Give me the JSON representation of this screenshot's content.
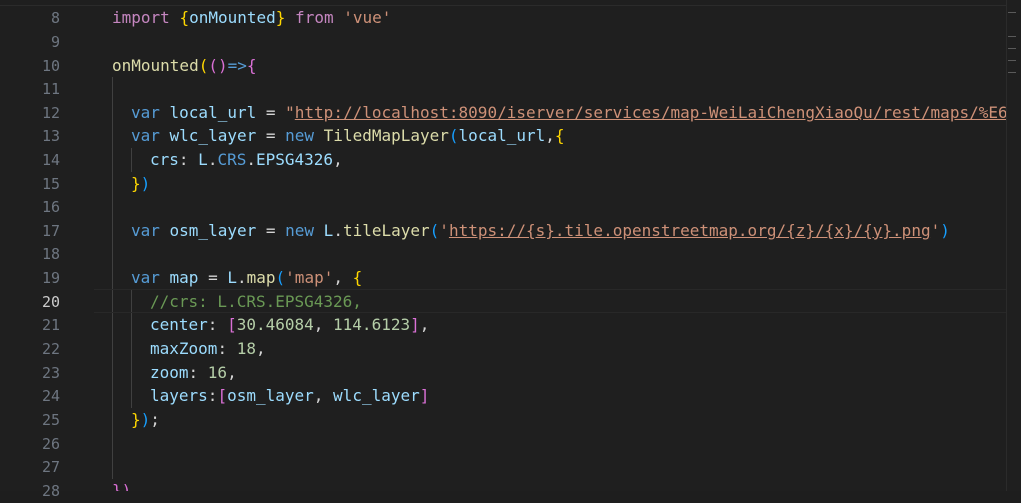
{
  "editor": {
    "line_numbers": [
      "8",
      "9",
      "10",
      "11",
      "12",
      "13",
      "14",
      "15",
      "16",
      "17",
      "18",
      "19",
      "20",
      "21",
      "22",
      "23",
      "24",
      "25",
      "26",
      "27",
      "28"
    ],
    "active_line": "20",
    "lines": {
      "l8": {
        "t1": "import ",
        "t2": "{",
        "t3": "onMounted",
        "t4": "}",
        "t5": " from ",
        "t6": "'vue'"
      },
      "l10": {
        "t1": "onMounted",
        "t2": "(",
        "t3": "()",
        "t4": "=>",
        "t5": "{"
      },
      "l12": {
        "t1": "var ",
        "t2": "local_url",
        "t3": " = ",
        "t4": "\"",
        "t5": "http://localhost:8090/iserver/services/map-WeiLaiChengXiaoQu/rest/maps/%E6"
      },
      "l13": {
        "t1": "var ",
        "t2": "wlc_layer",
        "t3": " = ",
        "t4": "new ",
        "t5": "TiledMapLayer",
        "t6": "(",
        "t7": "local_url",
        "t8": ",",
        "t9": "{"
      },
      "l14": {
        "t1": "crs",
        "t2": ": ",
        "t3": "L",
        "t4": ".",
        "t5": "CRS",
        "t6": ".",
        "t7": "EPSG4326",
        "t8": ","
      },
      "l15": {
        "t1": "}",
        "t2": ")"
      },
      "l17": {
        "t1": "var ",
        "t2": "osm_layer",
        "t3": " = ",
        "t4": "new ",
        "t5": "L",
        "t6": ".",
        "t7": "tileLayer",
        "t8": "(",
        "t9": "'",
        "t10": "https://{s}.tile.openstreetmap.org/{z}/{x}/{y}.png",
        "t11": "'",
        "t12": ")"
      },
      "l19": {
        "t1": "var ",
        "t2": "map",
        "t3": " = ",
        "t4": "L",
        "t5": ".",
        "t6": "map",
        "t7": "(",
        "t8": "'map'",
        "t9": ", ",
        "t10": "{"
      },
      "l20": {
        "t1": "//crs: L.CRS.EPSG4326,"
      },
      "l21": {
        "t1": "center",
        "t2": ": ",
        "t3": "[",
        "t4": "30.46084",
        "t5": ", ",
        "t6": "114.6123",
        "t7": "]",
        "t8": ","
      },
      "l22": {
        "t1": "maxZoom",
        "t2": ": ",
        "t3": "18",
        "t4": ","
      },
      "l23": {
        "t1": "zoom",
        "t2": ": ",
        "t3": "16",
        "t4": ","
      },
      "l24": {
        "t1": "layers",
        "t2": ":",
        "t3": "[",
        "t4": "osm_layer",
        "t5": ", ",
        "t6": "wlc_layer",
        "t7": "]"
      },
      "l25": {
        "t1": "}",
        "t2": ")",
        "t3": ";"
      },
      "l28": {
        "t1": "})"
      }
    }
  },
  "colors": {
    "background": "#1f1f1f",
    "keyword": "#569cd6",
    "string": "#ce9178",
    "comment": "#6a9955",
    "number": "#b5cea8",
    "variable": "#9cdcfe",
    "function": "#dcdcaa",
    "class": "#4ec9b0"
  }
}
